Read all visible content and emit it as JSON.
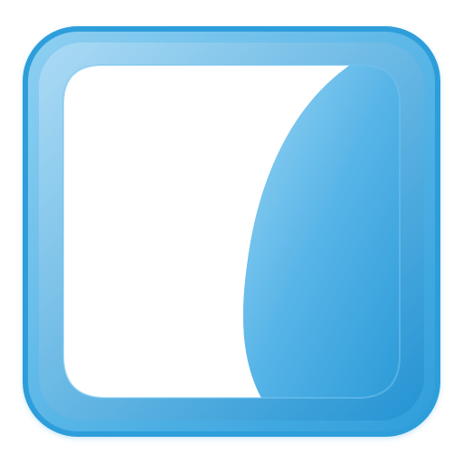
{
  "icon": {
    "name": "app-icon",
    "colors": {
      "frame_outer": "#2f9edb",
      "frame_light": "#b9e0f6",
      "frame_dark": "#1f8fd0",
      "panel": "#ffffff"
    }
  }
}
